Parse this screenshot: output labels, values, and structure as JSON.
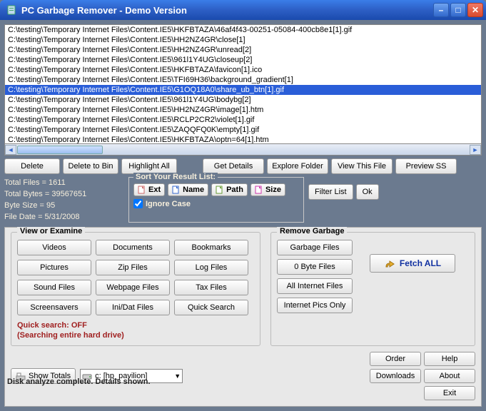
{
  "window": {
    "title": "PC Garbage Remover - Demo Version"
  },
  "files": [
    "C:\\testing\\Temporary Internet Files\\Content.IE5\\HKFBTAZA\\46af4f43-00251-05084-400cb8e1[1].gif",
    "C:\\testing\\Temporary Internet Files\\Content.IE5\\HH2NZ4GR\\close[1]",
    "C:\\testing\\Temporary Internet Files\\Content.IE5\\HH2NZ4GR\\unread[2]",
    "C:\\testing\\Temporary Internet Files\\Content.IE5\\961l1Y4UG\\closeup[2]",
    "C:\\testing\\Temporary Internet Files\\Content.IE5\\HKFBTAZA\\favicon[1].ico",
    "C:\\testing\\Temporary Internet Files\\Content.IE5\\TFI69H36\\background_gradient[1]",
    "C:\\testing\\Temporary Internet Files\\Content.IE5\\G1OQ18A0\\share_ub_btn[1].gif",
    "C:\\testing\\Temporary Internet Files\\Content.IE5\\961l1Y4UG\\bodybg[2]",
    "C:\\testing\\Temporary Internet Files\\Content.IE5\\HH2NZ4GR\\image[1].htm",
    "C:\\testing\\Temporary Internet Files\\Content.IE5\\RCLP2CR2\\violet[1].gif",
    "C:\\testing\\Temporary Internet Files\\Content.IE5\\ZAQQFQ0K\\empty[1].gif",
    "C:\\testing\\Temporary Internet Files\\Content.IE5\\HKFBTAZA\\optn=64[1].htm"
  ],
  "selectedIndex": 6,
  "toolbar": {
    "delete": "Delete",
    "deleteBin": "Delete to Bin",
    "highlight": "Highlight All",
    "getDetails": "Get Details",
    "explore": "Explore Folder",
    "viewFile": "View This File",
    "preview": "Preview SS"
  },
  "stats": {
    "l1": "Total Files = 1611",
    "l2": "Total Bytes = 39567651",
    "l3": "Byte Size   = 95",
    "l4": "File Date   = 5/31/2008"
  },
  "sort": {
    "legend": "Sort Your Result List:",
    "ext": "Ext",
    "name": "Name",
    "path": "Path",
    "size": "Size",
    "ignore": "Ignore Case"
  },
  "filter": {
    "label": "Filter List",
    "ok": "Ok"
  },
  "view": {
    "legend": "View or Examine",
    "videos": "Videos",
    "documents": "Documents",
    "bookmarks": "Bookmarks",
    "pictures": "Pictures",
    "zip": "Zip Files",
    "log": "Log Files",
    "sound": "Sound Files",
    "webpage": "Webpage Files",
    "tax": "Tax Files",
    "screensavers": "Screensavers",
    "inidat": "Ini/Dat Files",
    "quick": "Quick Search",
    "qs1": "Quick search: OFF",
    "qs2": "(Searching entire hard drive)"
  },
  "remove": {
    "legend": "Remove Garbage",
    "garbage": "Garbage Files",
    "zero": "0 Byte Files",
    "internet": "All Internet Files",
    "pics": "Internet Pics Only",
    "fetch": "Fetch ALL"
  },
  "bottom": {
    "showTotals": "Show Totals",
    "drive": "c: [hp_pavilion]",
    "order": "Order",
    "help": "Help",
    "downloads": "Downloads",
    "about": "About",
    "exit": "Exit"
  },
  "status": "Disk analyze complete. Details shown."
}
